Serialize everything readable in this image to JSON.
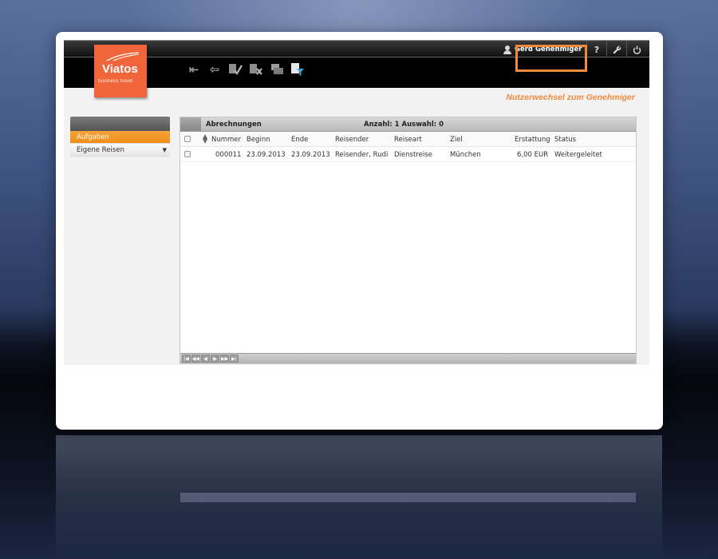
{
  "app": {
    "logo_name": "Viatos",
    "logo_sub": "business travel",
    "page_subtitle": "Nutzerwechsel zum Genehmiger"
  },
  "topbar": {
    "user_name": "Gerd Genehmiger",
    "help_icon": "help-icon",
    "settings_icon": "wrench-icon",
    "logout_icon": "power-icon"
  },
  "toolbar": {
    "icons": [
      "back-first-icon",
      "back-icon",
      "approve-icon",
      "reject-icon",
      "print-icon",
      "filter-icon"
    ]
  },
  "sidebar": {
    "items": [
      {
        "label": "Aufgaben",
        "active": true
      },
      {
        "label": "Eigene Reisen",
        "active": false
      }
    ]
  },
  "panel": {
    "title": "Abrechnungen",
    "count_text": "Anzahl: 1 Auswahl: 0",
    "columns": [
      "Nummer",
      "Beginn",
      "Ende",
      "Reisender",
      "Reiseart",
      "Ziel",
      "Erstattung",
      "Status"
    ],
    "rows": [
      [
        "000011",
        "23.09.2013",
        "23.09.2013",
        "Reisender, Rudi",
        "Dienstreise",
        "München",
        "6,00 EUR",
        "Weitergeleitet"
      ]
    ]
  },
  "colors": {
    "accent": "#f08a3c",
    "logo": "#f0663a",
    "active_tab": "#ef8f16"
  }
}
